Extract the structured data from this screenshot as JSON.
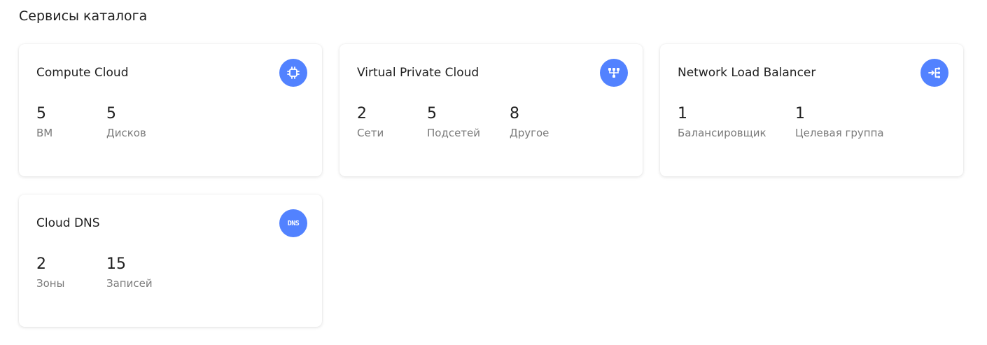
{
  "section": {
    "title": "Сервисы каталога"
  },
  "colors": {
    "accent": "#5282ff",
    "label": "#7a7a7a",
    "text": "#1f1f1f"
  },
  "cards": [
    {
      "title": "Compute Cloud",
      "icon": "chip-icon",
      "stats": [
        {
          "value": "5",
          "label": "ВМ"
        },
        {
          "value": "5",
          "label": "Дисков"
        }
      ]
    },
    {
      "title": "Virtual Private Cloud",
      "icon": "network-icon",
      "stats": [
        {
          "value": "2",
          "label": "Сети"
        },
        {
          "value": "5",
          "label": "Подсетей"
        },
        {
          "value": "8",
          "label": "Другое"
        }
      ]
    },
    {
      "title": "Network Load Balancer",
      "icon": "load-balancer-icon",
      "stats": [
        {
          "value": "1",
          "label": "Балансировщик"
        },
        {
          "value": "1",
          "label": "Целевая группа"
        }
      ]
    },
    {
      "title": "Cloud DNS",
      "icon": "dns-icon",
      "icon_text": "DNS",
      "stats": [
        {
          "value": "2",
          "label": "Зоны"
        },
        {
          "value": "15",
          "label": "Записей"
        }
      ]
    }
  ]
}
